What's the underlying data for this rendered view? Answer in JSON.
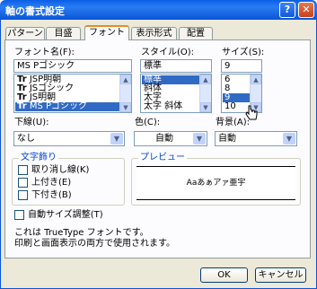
{
  "window": {
    "title": "軸の書式設定",
    "help_glyph": "?",
    "close_glyph": "✕"
  },
  "tabs": [
    {
      "label": "パターン"
    },
    {
      "label": "目盛"
    },
    {
      "label": "フォント",
      "active": true
    },
    {
      "label": "表示形式"
    },
    {
      "label": "配置"
    }
  ],
  "font": {
    "label": "フォント名(F):",
    "value": "MS Pゴシック",
    "items": [
      {
        "icon": "Tr",
        "name": "JSP明朝"
      },
      {
        "icon": "Tr",
        "name": "JSゴシック"
      },
      {
        "icon": "Tr",
        "name": "JS明朝"
      },
      {
        "icon": "Tr",
        "name": "MS Pゴシック",
        "selected": true
      }
    ]
  },
  "style": {
    "label": "スタイル(O):",
    "value": "標準",
    "items": [
      "標準",
      "斜体",
      "太字",
      "太字 斜体"
    ]
  },
  "size": {
    "label": "サイズ(S):",
    "value": "9",
    "items": [
      "6",
      "8",
      "9",
      "10"
    ]
  },
  "underline": {
    "label": "下線(U):",
    "value": "なし"
  },
  "color": {
    "label": "色(C):",
    "value": "自動"
  },
  "background": {
    "label": "背景(A):",
    "value": "自動"
  },
  "effects": {
    "title": "文字飾り",
    "items": [
      "取り消し線(K)",
      "上付き(E)",
      "下付き(B)"
    ]
  },
  "preview": {
    "title": "プレビュー",
    "sample": "Aaあぁアァ亜宇"
  },
  "autoscale": {
    "label": "自動サイズ調整(T)"
  },
  "info": {
    "line1": "これは TrueType フォントです。",
    "line2": "印刷と画面表示の両方で使用されます。"
  },
  "buttons": {
    "ok": "OK",
    "cancel": "キャンセル"
  },
  "colors": {
    "title_bar": "#0a55d8",
    "selection": "#316ac5",
    "group_title": "#0046d5",
    "dialog_bg": "#ece9d8"
  }
}
